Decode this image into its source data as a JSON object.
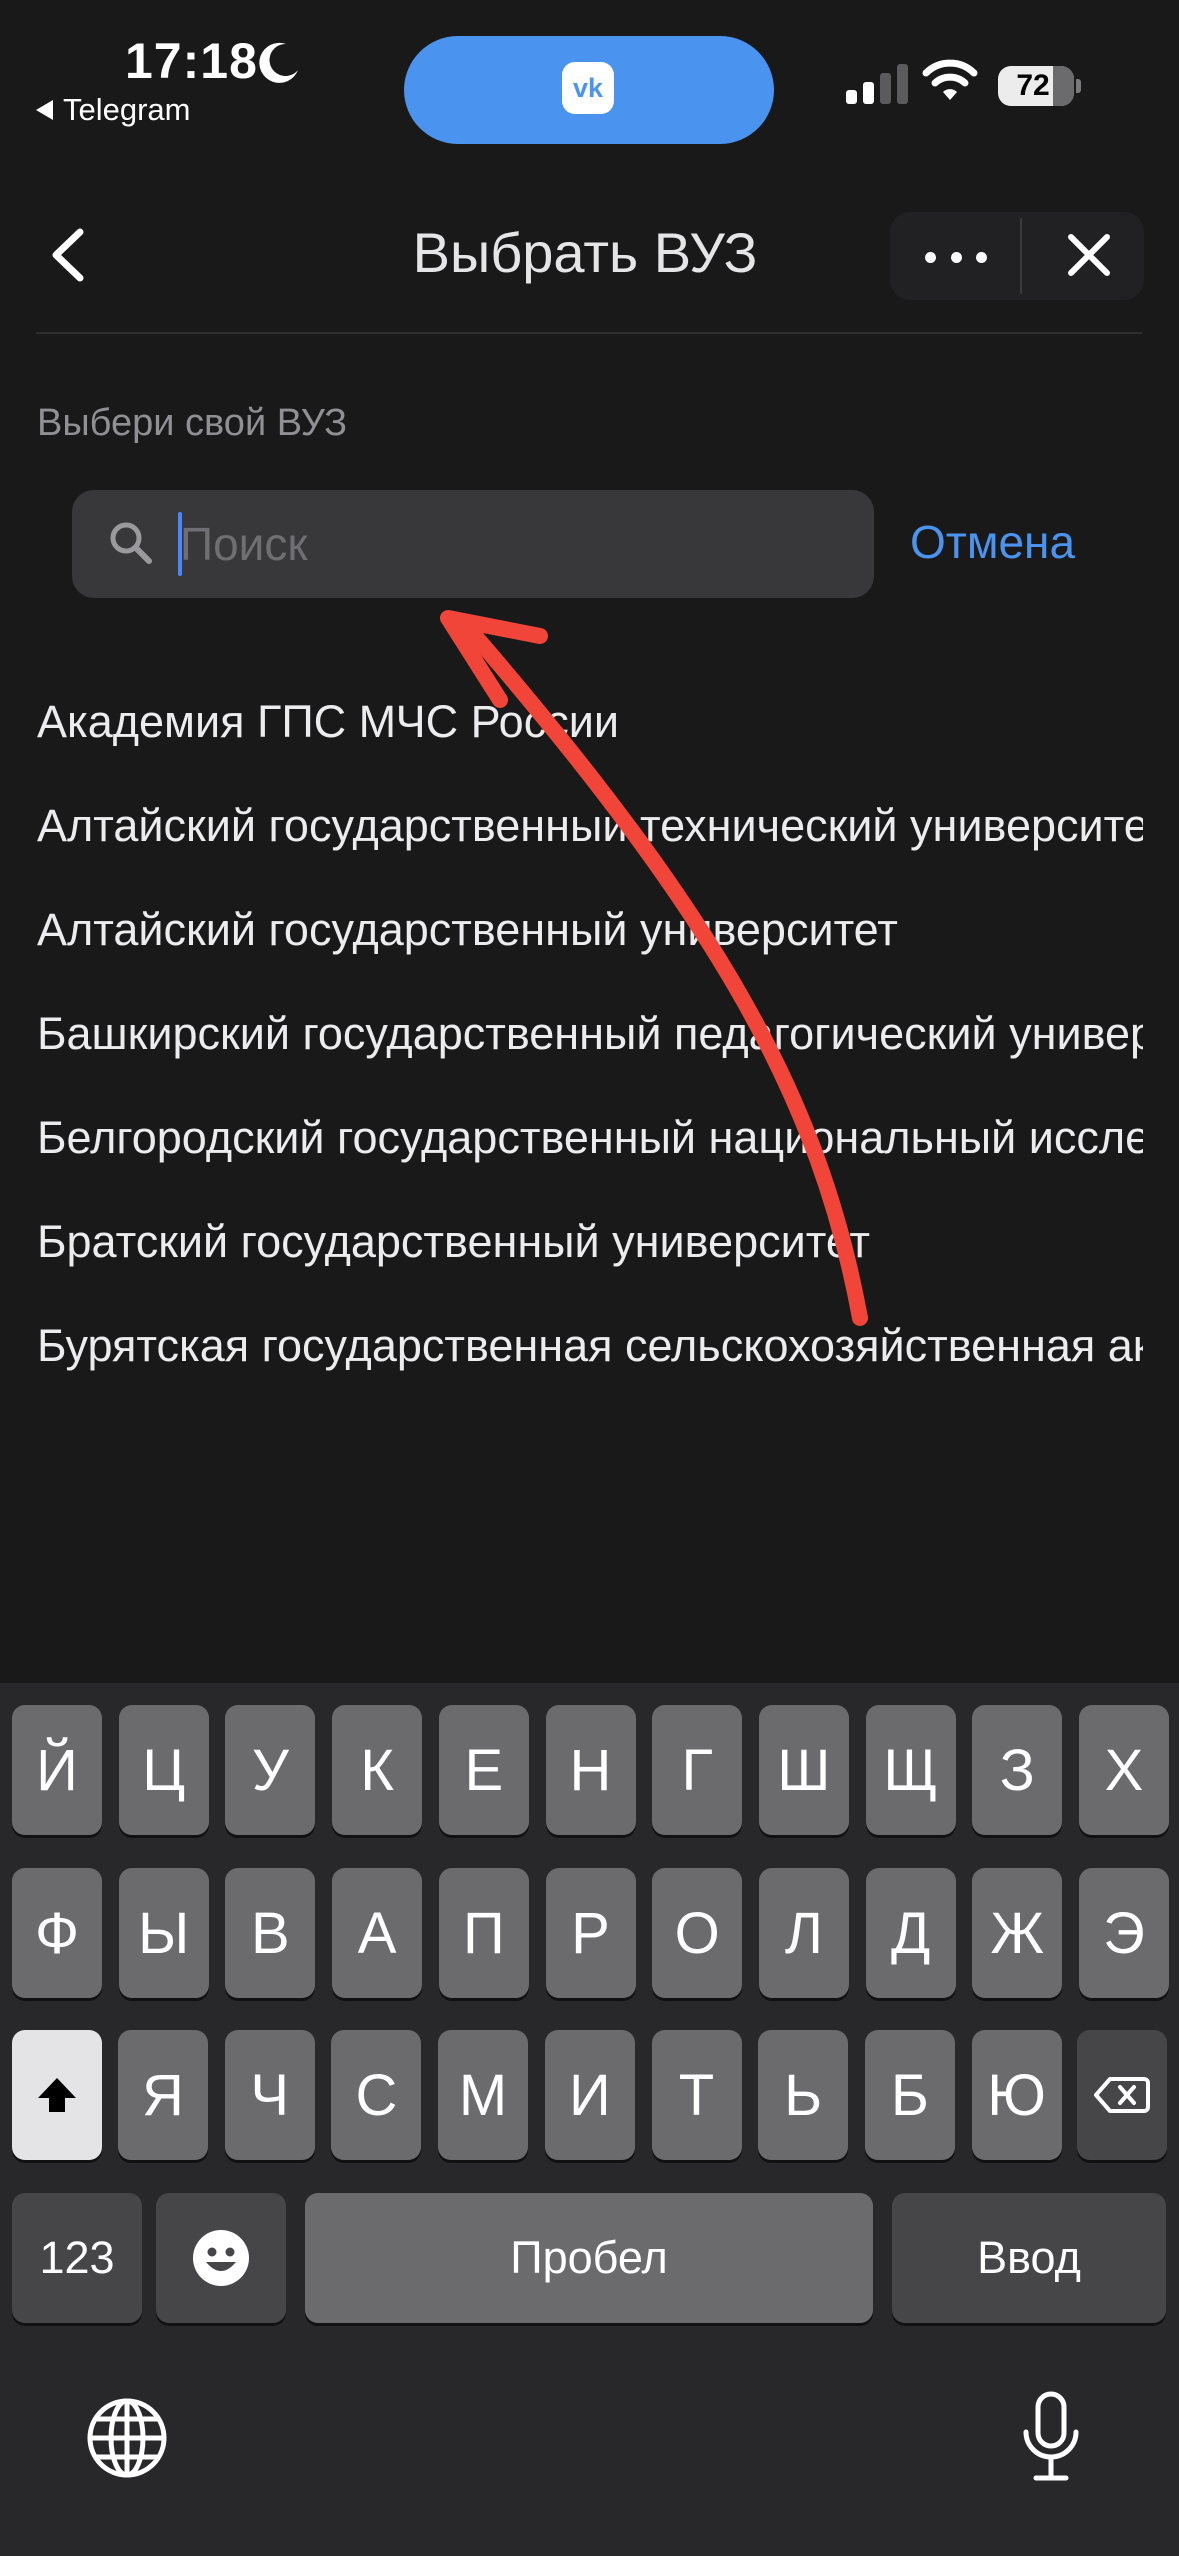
{
  "status_bar": {
    "time": "17:18",
    "back_app": "Telegram",
    "pill_app": "vk",
    "battery": "72",
    "icons": [
      "moon-icon",
      "signal-icon",
      "wifi-icon",
      "battery-icon"
    ]
  },
  "nav": {
    "title": "Выбрать ВУЗ",
    "back_icon": "chevron-left-icon",
    "more_icon": "more-dots-icon",
    "close_icon": "close-icon"
  },
  "search": {
    "label": "Выбери свой ВУЗ",
    "placeholder": "Поиск",
    "value": "",
    "cancel": "Отмена"
  },
  "universities": [
    "Академия ГПС МЧС России",
    "Алтайский государственный технический университет",
    "Алтайский государственный университет",
    "Башкирский государственный педагогический университет",
    "Белгородский государственный национальный исследовательский университет",
    "Братский государственный университет",
    "Бурятская государственная сельскохозяйственная академия"
  ],
  "keyboard": {
    "row1": [
      "Й",
      "Ц",
      "У",
      "К",
      "Е",
      "Н",
      "Г",
      "Ш",
      "Щ",
      "З",
      "Х"
    ],
    "row2": [
      "Ф",
      "Ы",
      "В",
      "А",
      "П",
      "Р",
      "О",
      "Л",
      "Д",
      "Ж",
      "Э"
    ],
    "row3": [
      "Я",
      "Ч",
      "С",
      "М",
      "И",
      "Т",
      "Ь",
      "Б",
      "Ю"
    ],
    "numbers": "123",
    "space": "Пробел",
    "enter": "Ввод",
    "shift_icon": "shift-icon",
    "backspace_icon": "backspace-icon",
    "emoji_icon": "emoji-icon",
    "globe_icon": "globe-icon",
    "mic_icon": "microphone-icon"
  },
  "colors": {
    "background": "#19191a",
    "accent": "#4a94ef",
    "annotation_arrow": "#f2453a"
  }
}
